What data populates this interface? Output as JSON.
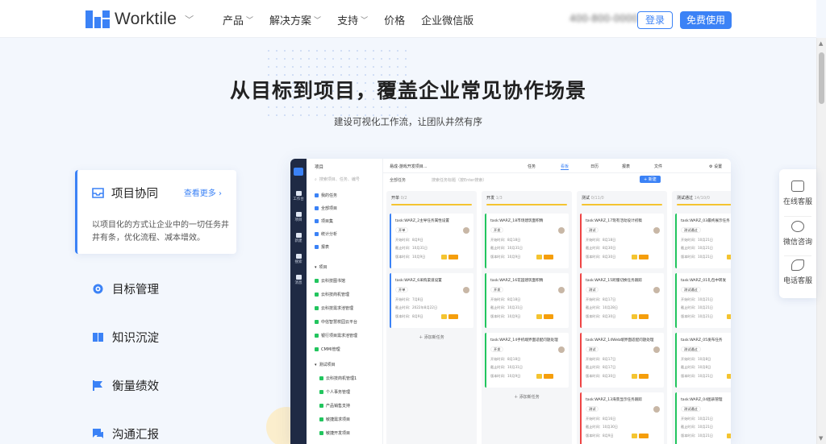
{
  "header": {
    "brand": "Worktile",
    "nav": [
      {
        "label": "产品",
        "dropdown": true
      },
      {
        "label": "解决方案",
        "dropdown": true
      },
      {
        "label": "支持",
        "dropdown": true
      },
      {
        "label": "价格",
        "dropdown": false
      },
      {
        "label": "企业微信版",
        "dropdown": false
      }
    ],
    "phone": "400-800-0000",
    "login": "登录",
    "free": "免费使用"
  },
  "hero": {
    "title": "从目标到项目，覆盖企业常见协作场景",
    "subtitle": "建设可视化工作流，让团队井然有序"
  },
  "features": {
    "active": {
      "title": "项目协同",
      "more": "查看更多",
      "desc": "以项目化的方式让企业中的一切任务井井有条，优化流程、减本增效。"
    },
    "items": [
      "目标管理",
      "知识沉淀",
      "衡量绩效",
      "沟通汇报"
    ]
  },
  "app": {
    "rail": [
      "工作台",
      "项目",
      "新建",
      "搜索",
      "消息"
    ],
    "tree": {
      "title": "项目",
      "search": "搜索项目、任务、编号",
      "links": [
        "我的任务",
        "全部项目",
        "项目集",
        "统计分析",
        "报表"
      ],
      "section": "项目",
      "projects": [
        "云科技图书馆",
        "云科技商机管理",
        "云科技需求池管理",
        "中信智慧校园云平台",
        "银行项目需求池管理",
        "CMMI管理"
      ],
      "group": "测试项目",
      "group_items": [
        "云科技商机管理1",
        "个人事务管理",
        "产品销售支持",
        "敏捷需求项目",
        "敏捷开发项目"
      ]
    },
    "topbar": {
      "project": "易成-游戏开发项目...",
      "tabs": [
        "任务",
        "看板",
        "日历",
        "报表",
        "文件"
      ],
      "active": "看板",
      "settings": "设置"
    },
    "toolbar": {
      "filter": "全部任务",
      "search": "搜索任务标题（按Enter搜索）",
      "new": "+ 新建"
    },
    "columns": [
      {
        "name": "开单",
        "count": "0/2",
        "color": "#f4c430",
        "cards": [
          {
            "title": "task:WARZ_2主导任务属性设置",
            "status": "开单",
            "l1": "开始时间：8月9日",
            "l2": "截止时间：10月31日",
            "l3": "版本时间：10月9日"
          },
          {
            "title": "task:WARZ_6采购渠道设置",
            "status": "开单",
            "l1": "开始时间：7月8日",
            "l2": "截止时间：2022年8月22日",
            "l3": "版本时间：8月9日"
          }
        ],
        "add": "添加新任务"
      },
      {
        "name": "开发",
        "count": "1/3",
        "color": "#f4c430",
        "cards": [
          {
            "title": "task:WARZ_18市场建筑面积精",
            "status": "开发",
            "l1": "开始时间：8月18日",
            "l2": "截止时间：10月31日",
            "l3": "版本时间：10月9日"
          },
          {
            "title": "task:WARZ_16花园建筑面积精",
            "status": "开发",
            "l1": "开始时间：8月18日",
            "l2": "截止时间：10月31日",
            "l3": "版本时间：10月9日"
          },
          {
            "title": "task:WARZ_14手机端界面适配问题处理",
            "status": "开发",
            "l1": "开始时间：8月18日",
            "l2": "截止时间：10月31日",
            "l3": "版本时间：10月9日"
          }
        ],
        "add": "添加新任务"
      },
      {
        "name": "测试",
        "count": "0/11/0",
        "color": "#f4c430",
        "cards": [
          {
            "title": "task:WARZ_17现有活动设计初稿",
            "status": "测试",
            "l1": "开始时间：8月18日",
            "l2": "截止时间：8月30日",
            "l3": "版本时间：8月30日"
          },
          {
            "title": "task:WARZ_15跨服切换任务跟踪",
            "status": "测试",
            "l1": "开始时间：8月17日",
            "l2": "截止时间：10月28日",
            "l3": "版本时间：8月30日"
          },
          {
            "title": "task:WARZ_14Web端界面适配问题处理",
            "status": "测试",
            "l1": "开始时间：8月17日",
            "l2": "截止时间：8月17日",
            "l3": "版本时间：8月30日"
          },
          {
            "title": "task:WARZ_13海景显示任务跟踪",
            "status": "测试",
            "l1": "开始时间：8月16日",
            "l2": "截止时间：10月30日",
            "l3": "版本时间：8月9日"
          }
        ],
        "add": "添加新任务"
      },
      {
        "name": "测试通过",
        "count": "14/10/0",
        "color": "#f4c430",
        "cards": [
          {
            "title": "task:WARZ_03最终展示任务",
            "status": "测试通过",
            "l1": "开始时间：10月21日",
            "l2": "截止时间：10月21日",
            "l3": "版本时间：10月21日"
          },
          {
            "title": "task:WARZ_01礼包中转发",
            "status": "测试通过",
            "l1": "开始时间：10月21日",
            "l2": "截止时间：10月21日",
            "l3": "版本时间：10月21日"
          },
          {
            "title": "task:WARZ_05发布任务",
            "status": "测试通过",
            "l1": "开始时间：10月8日",
            "l2": "截止时间：10月8日",
            "l3": "版本时间：10月21日"
          },
          {
            "title": "task:WARZ_04图表管理",
            "status": "测试通过",
            "l1": "开始时间：10月21日",
            "l2": "截止时间：10月21日",
            "l3": "版本时间：10月21日"
          }
        ],
        "add": "添加新任务"
      }
    ]
  },
  "floating": [
    "在线客服",
    "微信咨询",
    "电话客服"
  ]
}
